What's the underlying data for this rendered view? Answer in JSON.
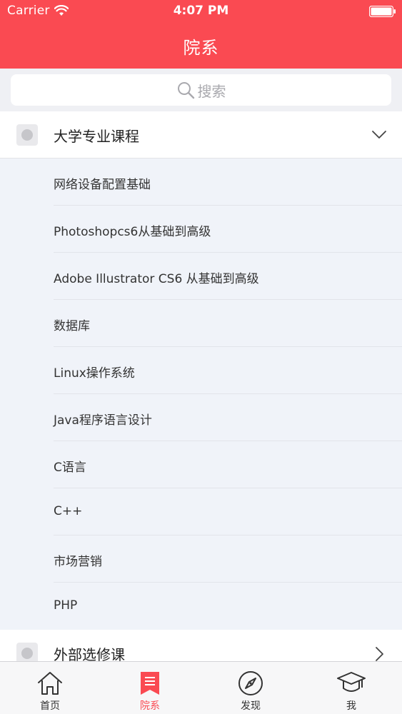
{
  "status_bar": {
    "carrier": "Carrier",
    "time": "4:07 PM"
  },
  "header": {
    "title": "院系"
  },
  "search": {
    "placeholder": "搜索"
  },
  "sections": [
    {
      "label": "大学专业课程",
      "expanded": true
    },
    {
      "label": "外部选修课",
      "expanded": false
    }
  ],
  "courses": [
    "网络设备配置基础",
    "Photoshopcs6从基础到高级",
    "Adobe Illustrator CS6 从基础到高级",
    "数据库",
    "Linux操作系统",
    "Java程序语言设计",
    "C语言",
    "C++",
    "市场营销",
    "PHP"
  ],
  "tabbar": {
    "home": "首页",
    "departments": "院系",
    "discover": "发现",
    "me": "我"
  },
  "colors": {
    "accent": "#fa4a52"
  }
}
